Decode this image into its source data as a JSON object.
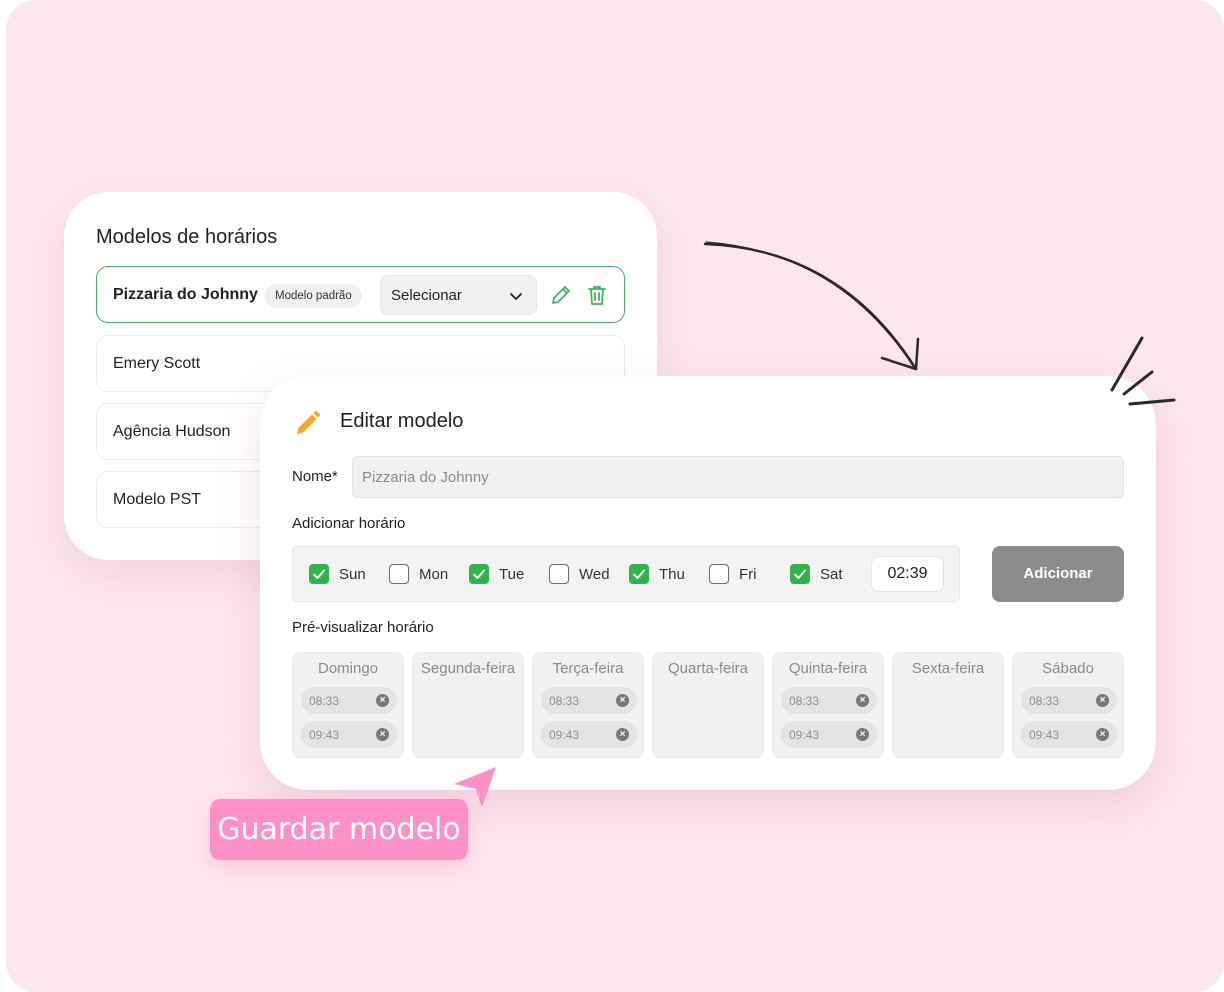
{
  "colors": {
    "background": "#fde6ef",
    "accent_green": "#3fb55a",
    "checkbox_green": "#2fb34b",
    "pencil_orange": "#f5a623",
    "cta_pink": "#ff90c6",
    "add_button_gray": "#8c8c8c"
  },
  "templates_card": {
    "title": "Modelos de horários",
    "items": [
      {
        "label": "Pizzaria do Johnny",
        "active": true,
        "badge": "Modelo padrão",
        "select_value": "Selecionar",
        "icons": [
          "chevron-down-icon",
          "pencil-icon",
          "trash-icon"
        ]
      },
      {
        "label": "Emery Scott",
        "active": false
      },
      {
        "label": "Agência Hudson",
        "active": false
      },
      {
        "label": "Modelo PST",
        "active": false
      }
    ]
  },
  "edit_card": {
    "title": "Editar modelo",
    "title_icon": "pencil-icon",
    "name_label": "Nome*",
    "name_placeholder": "Pizzaria do Johnny",
    "add_schedule_label": "Adicionar horário",
    "days": [
      {
        "label": "Sun",
        "checked": true
      },
      {
        "label": "Mon",
        "checked": false
      },
      {
        "label": "Tue",
        "checked": true
      },
      {
        "label": "Wed",
        "checked": false
      },
      {
        "label": "Thu",
        "checked": true
      },
      {
        "label": "Fri",
        "checked": false
      },
      {
        "label": "Sat",
        "checked": true
      }
    ],
    "time_value": "02:39",
    "add_button": "Adicionar",
    "preview_label": "Pré-visualizar horário",
    "preview_columns": [
      {
        "name": "Domingo",
        "times": [
          "08:33",
          "09:43"
        ]
      },
      {
        "name": "Segunda-feira",
        "times": []
      },
      {
        "name": "Terça-feira",
        "times": [
          "08:33",
          "09:43"
        ]
      },
      {
        "name": "Quarta-feira",
        "times": []
      },
      {
        "name": "Quinta-feira",
        "times": [
          "08:33",
          "09:43"
        ]
      },
      {
        "name": "Sexta-feira",
        "times": []
      },
      {
        "name": "Sábado",
        "times": [
          "08:33",
          "09:43"
        ]
      }
    ]
  },
  "cta": {
    "label": "Guardar modelo"
  }
}
